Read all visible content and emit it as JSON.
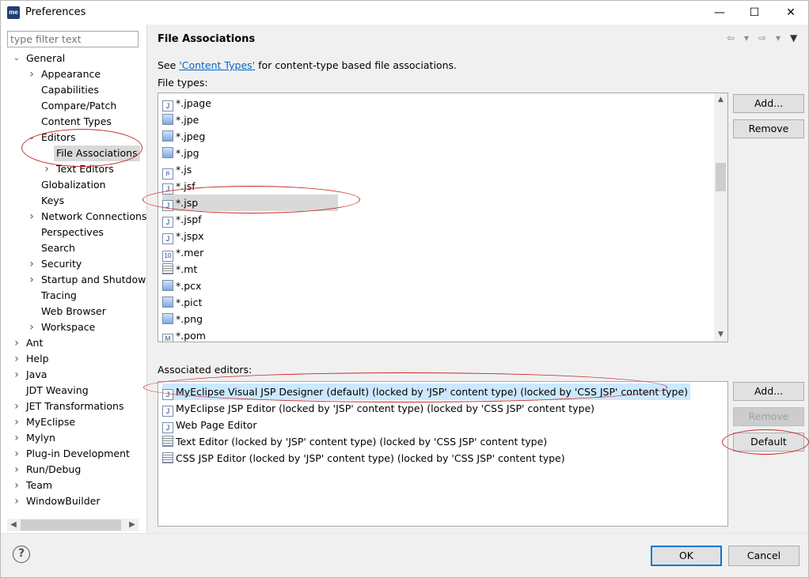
{
  "window": {
    "title": "Preferences",
    "app_icon": "me",
    "min": "—",
    "max": "☐",
    "close": "✕"
  },
  "filter": {
    "placeholder": "type filter text"
  },
  "tree": [
    {
      "label": "General",
      "level": 0,
      "twisty": "expanded"
    },
    {
      "label": "Appearance",
      "level": 1,
      "twisty": "collapsed"
    },
    {
      "label": "Capabilities",
      "level": 1,
      "twisty": "none"
    },
    {
      "label": "Compare/Patch",
      "level": 1,
      "twisty": "none"
    },
    {
      "label": "Content Types",
      "level": 1,
      "twisty": "none"
    },
    {
      "label": "Editors",
      "level": 1,
      "twisty": "expanded"
    },
    {
      "label": "File Associations",
      "level": 2,
      "twisty": "none",
      "selected": true
    },
    {
      "label": "Text Editors",
      "level": 2,
      "twisty": "collapsed"
    },
    {
      "label": "Globalization",
      "level": 1,
      "twisty": "none"
    },
    {
      "label": "Keys",
      "level": 1,
      "twisty": "none"
    },
    {
      "label": "Network Connections",
      "level": 1,
      "twisty": "collapsed"
    },
    {
      "label": "Perspectives",
      "level": 1,
      "twisty": "none"
    },
    {
      "label": "Search",
      "level": 1,
      "twisty": "none"
    },
    {
      "label": "Security",
      "level": 1,
      "twisty": "collapsed"
    },
    {
      "label": "Startup and Shutdown",
      "level": 1,
      "twisty": "collapsed"
    },
    {
      "label": "Tracing",
      "level": 1,
      "twisty": "none"
    },
    {
      "label": "Web Browser",
      "level": 1,
      "twisty": "none"
    },
    {
      "label": "Workspace",
      "level": 1,
      "twisty": "collapsed"
    },
    {
      "label": "Ant",
      "level": 0,
      "twisty": "collapsed"
    },
    {
      "label": "Help",
      "level": 0,
      "twisty": "collapsed"
    },
    {
      "label": "Java",
      "level": 0,
      "twisty": "collapsed"
    },
    {
      "label": "JDT Weaving",
      "level": 0,
      "twisty": "none"
    },
    {
      "label": "JET Transformations",
      "level": 0,
      "twisty": "collapsed"
    },
    {
      "label": "MyEclipse",
      "level": 0,
      "twisty": "collapsed"
    },
    {
      "label": "Mylyn",
      "level": 0,
      "twisty": "collapsed"
    },
    {
      "label": "Plug-in Development",
      "level": 0,
      "twisty": "collapsed"
    },
    {
      "label": "Run/Debug",
      "level": 0,
      "twisty": "collapsed"
    },
    {
      "label": "Team",
      "level": 0,
      "twisty": "collapsed"
    },
    {
      "label": "WindowBuilder",
      "level": 0,
      "twisty": "collapsed"
    }
  ],
  "page": {
    "title": "File Associations",
    "see_prefix": "See ",
    "see_link": "'Content Types'",
    "see_suffix": " for content-type based file associations.",
    "file_types_label": "File types:",
    "associated_label": "Associated editors:"
  },
  "file_types": [
    {
      "name": "*.jpage",
      "icon": "J"
    },
    {
      "name": "*.jpe",
      "icon": "img"
    },
    {
      "name": "*.jpeg",
      "icon": "img"
    },
    {
      "name": "*.jpg",
      "icon": "img"
    },
    {
      "name": "*.js",
      "icon": "js"
    },
    {
      "name": "*.jsf",
      "icon": "J"
    },
    {
      "name": "*.jsp",
      "icon": "J",
      "selected": true
    },
    {
      "name": "*.jspf",
      "icon": "J"
    },
    {
      "name": "*.jspx",
      "icon": "J"
    },
    {
      "name": "*.mer",
      "icon": "10"
    },
    {
      "name": "*.mt",
      "icon": "txt"
    },
    {
      "name": "*.pcx",
      "icon": "img"
    },
    {
      "name": "*.pict",
      "icon": "img"
    },
    {
      "name": "*.png",
      "icon": "img"
    },
    {
      "name": "*.pom",
      "icon": "M"
    }
  ],
  "editors": [
    {
      "name": "MyEclipse Visual JSP Designer (default) (locked by 'JSP' content type) (locked by 'CSS JSP' content type)",
      "icon": "J",
      "selected": true
    },
    {
      "name": "MyEclipse JSP Editor (locked by 'JSP' content type) (locked by 'CSS JSP' content type)",
      "icon": "J"
    },
    {
      "name": "Web Page Editor",
      "icon": "J"
    },
    {
      "name": "Text Editor (locked by 'JSP' content type) (locked by 'CSS JSP' content type)",
      "icon": "txt"
    },
    {
      "name": "CSS JSP Editor (locked by 'JSP' content type) (locked by 'CSS JSP' content type)",
      "icon": "txt"
    }
  ],
  "buttons": {
    "add_type": "Add...",
    "remove_type": "Remove",
    "add_editor": "Add...",
    "remove_editor": "Remove",
    "default_editor": "Default",
    "ok": "OK",
    "cancel": "Cancel",
    "help": "?"
  },
  "nav": {
    "back": "⇦",
    "back_menu": "▾",
    "forward": "⇨",
    "forward_menu": "▾",
    "view_menu": "▼"
  }
}
